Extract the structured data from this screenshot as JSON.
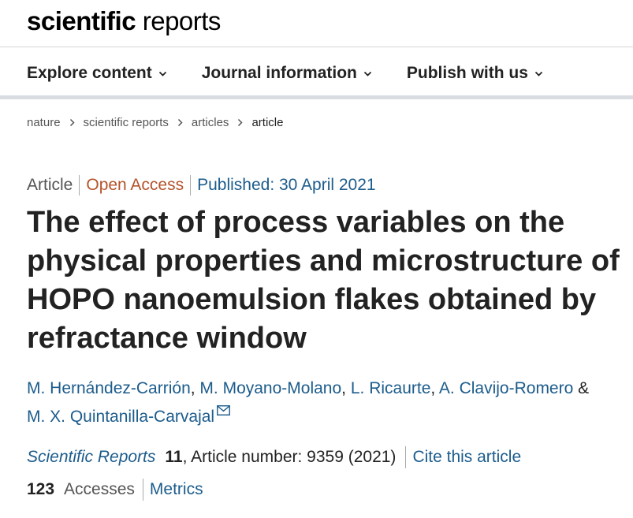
{
  "brand": {
    "part1": "scientific",
    "part2": " reports"
  },
  "nav": {
    "items": [
      {
        "label": "Explore content"
      },
      {
        "label": "Journal information"
      },
      {
        "label": "Publish with us"
      }
    ]
  },
  "breadcrumb": {
    "items": [
      {
        "label": "nature"
      },
      {
        "label": "scientific reports"
      },
      {
        "label": "articles"
      },
      {
        "label": "article"
      }
    ]
  },
  "article": {
    "type": "Article",
    "access": "Open Access",
    "published": "Published: 30 April 2021",
    "title": "The effect of process variables on the physical properties and microstructure of HOPO nanoemulsion flakes obtained by refractance window",
    "authors": [
      "M. Hernández-Carrión",
      "M. Moyano-Molano",
      "L. Ricaurte",
      "A. Clavijo-Romero",
      "M. X. Quintanilla-Carvajal"
    ],
    "author_separator": ", ",
    "author_ampersand": " & ",
    "journal": "Scientific Reports",
    "volume": "11",
    "article_number": ", Article number: 9359 (2021)",
    "cite_label": "Cite this article",
    "accesses_count": "123",
    "accesses_label": "Accesses",
    "metrics_label": "Metrics"
  },
  "colors": {
    "link": "#1c5c8c",
    "open_access": "#b5532b",
    "text": "#222222",
    "muted": "#555555",
    "nav_rule": "#d9dde2"
  },
  "icons": {
    "nav_dropdown": "chevron-down-icon",
    "breadcrumb_separator": "chevron-right-icon",
    "corresponding_author": "envelope-icon"
  }
}
